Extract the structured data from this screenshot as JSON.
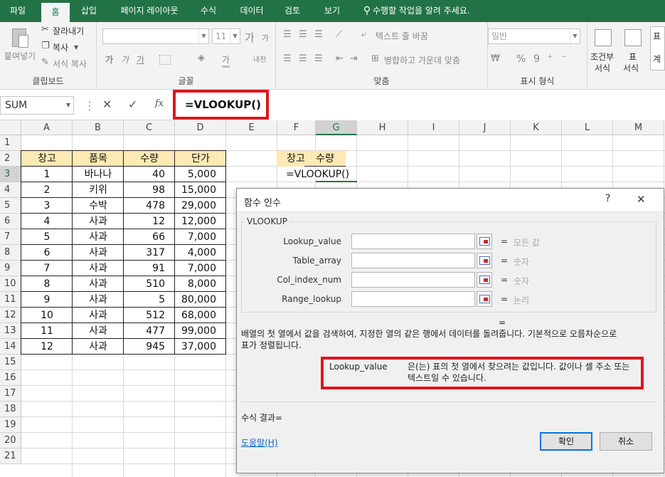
{
  "menu": {
    "file": "파일",
    "tabs": [
      "홈",
      "삽입",
      "페이지 레이아웃",
      "수식",
      "데이터",
      "검토",
      "보기"
    ],
    "tell_me": "수행할 작업을 알려 주세요."
  },
  "ribbon": {
    "clipboard": {
      "paste": "붙여넣기",
      "cut": "잘라내기",
      "copy": "복사",
      "format_painter": "서식 복사",
      "label": "클립보드"
    },
    "font": {
      "size": "11",
      "grow": "가",
      "shrink": "가",
      "bold": "가",
      "italic": "가",
      "underline": "가",
      "font_color": "가",
      "phonetic": "내천",
      "label": "글꼴"
    },
    "alignment": {
      "wrap": "텍스트 줄 바꿈",
      "merge": "병합하고 가운데 맞춤",
      "label": "맞춤"
    },
    "number": {
      "format": "일반",
      "percent": "%",
      "comma": "9",
      "label": "표시 형식"
    },
    "styles": {
      "conditional_line1": "조건부",
      "conditional_line2": "서식",
      "table_line1": "표",
      "table_line2": "서식",
      "cell_style_top": "표",
      "cell_style_bottom": "계"
    }
  },
  "formula_bar": {
    "name_box": "SUM",
    "cancel": "✕",
    "enter": "✓",
    "fx": "fx",
    "formula": "=VLOOKUP()"
  },
  "sheet": {
    "columns": [
      "A",
      "B",
      "C",
      "D",
      "E",
      "F",
      "G",
      "H",
      "I",
      "J",
      "K",
      "L",
      "M"
    ],
    "rows": [
      "1",
      "2",
      "3",
      "4",
      "5",
      "6",
      "7",
      "8",
      "9",
      "10",
      "11",
      "12",
      "13",
      "14",
      "15",
      "16",
      "17",
      "18",
      "19",
      "20",
      "21"
    ],
    "table_headers": [
      "창고",
      "품목",
      "수량",
      "단가"
    ],
    "table_rows": [
      [
        "1",
        "바나나",
        "40",
        "5,000"
      ],
      [
        "2",
        "키위",
        "98",
        "15,000"
      ],
      [
        "3",
        "수박",
        "478",
        "29,000"
      ],
      [
        "4",
        "사과",
        "12",
        "12,000"
      ],
      [
        "5",
        "사과",
        "66",
        "7,000"
      ],
      [
        "6",
        "사과",
        "317",
        "4,000"
      ],
      [
        "7",
        "사과",
        "91",
        "7,000"
      ],
      [
        "8",
        "사과",
        "510",
        "8,000"
      ],
      [
        "9",
        "사과",
        "5",
        "80,000"
      ],
      [
        "10",
        "사과",
        "512",
        "68,000"
      ],
      [
        "11",
        "사과",
        "477",
        "99,000"
      ],
      [
        "12",
        "사과",
        "945",
        "37,000"
      ]
    ],
    "lookup_headers": [
      "창고",
      "수량"
    ],
    "editing_cell": "=VLOOKUP()"
  },
  "dialog": {
    "title": "함수 인수",
    "help_glyph": "?",
    "close_glyph": "✕",
    "function_name": "VLOOKUP",
    "args": [
      {
        "label": "Lookup_value",
        "result": "모든 값"
      },
      {
        "label": "Table_array",
        "result": "숫자"
      },
      {
        "label": "Col_index_num",
        "result": "숫자"
      },
      {
        "label": "Range_lookup",
        "result": "논리"
      }
    ],
    "equals": "=",
    "description_line1": "배열의 첫 열에서 값을 검색하여, 지정한 열의 같은 행에서 데이터를 돌려줍니다. 기본적으로 오름차순으로",
    "description_line2": "표가 정렬됩니다.",
    "arg_name": "Lookup_value",
    "arg_help_line1": "은(는) 표의 첫 열에서 찾으려는 값입니다. 값이나 셀 주소 또는",
    "arg_help_line2": "텍스트일 수 있습니다.",
    "result_label": "수식 결과=",
    "help_link": "도움말(H)",
    "ok": "확인",
    "cancel": "취소"
  },
  "colors": {
    "excel_green": "#217346",
    "header_fill": "#fde9b4",
    "highlight_red": "#e0141e",
    "link_blue": "#0a64c8"
  }
}
